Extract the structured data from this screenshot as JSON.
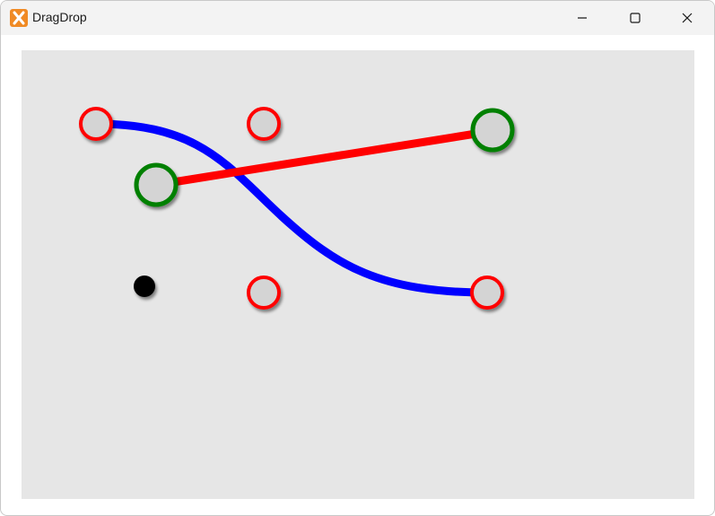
{
  "window": {
    "title": "DragDrop"
  },
  "icons": {
    "app": "app-icon",
    "minimize": "minimize-icon",
    "maximize": "maximize-icon",
    "close": "close-icon"
  },
  "colors": {
    "canvas_background": "#e6e6e6",
    "node_fill": "#d4d4d4",
    "unconnected_node_ring": "#ff0000",
    "connected_node_ring": "#008000",
    "curve_connection": "#0000ff",
    "straight_connection": "#ff0000",
    "drag_handle": "#000000"
  }
}
